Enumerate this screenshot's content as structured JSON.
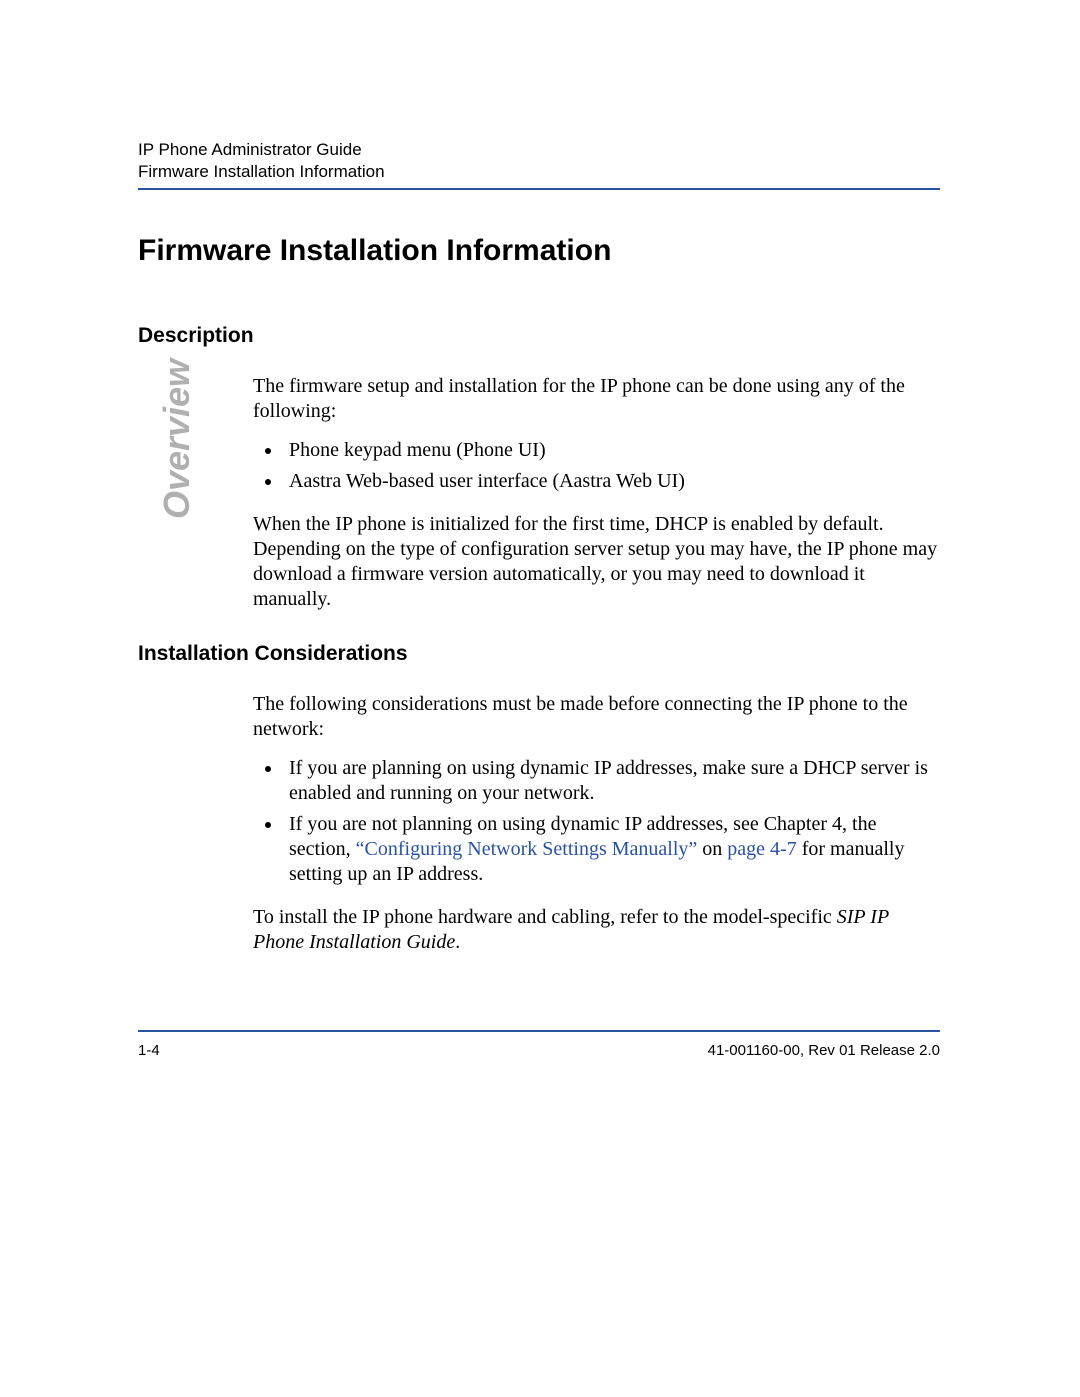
{
  "header": {
    "line1": "IP Phone Administrator Guide",
    "line2": "Firmware Installation Information"
  },
  "sideTab": "Overview",
  "mainTitle": "Firmware Installation Information",
  "sections": {
    "description": {
      "title": "Description",
      "intro": "The firmware setup and installation for the IP phone can be done using any of the following:",
      "bullets": [
        "Phone keypad menu (Phone UI)",
        "Aastra Web-based user interface (Aastra Web UI)"
      ],
      "para2": "When the IP phone is initialized for the first time, DHCP is enabled by default. Depending on the type of configuration server setup you may have, the IP phone may download a firmware version automatically, or you may need to download it manually."
    },
    "considerations": {
      "title": "Installation Considerations",
      "intro": "The following considerations must be made before connecting the IP phone to the network:",
      "bullets": [
        {
          "text": "If you are planning on using dynamic IP addresses, make sure a DHCP server is enabled and running on your network."
        },
        {
          "prefix": "If you are not planning on using dynamic IP addresses, see Chapter 4, the section, ",
          "linkText": "“Configuring Network Settings Manually”",
          "mid": " on ",
          "pageRef": "page 4-7",
          "suffix": " for manually setting up an IP address."
        }
      ],
      "closingPrefix": "To install the IP phone hardware and cabling, refer to the model-specific ",
      "closingItalic": "SIP IP Phone Installation Guide",
      "closingSuffix": "."
    }
  },
  "footer": {
    "left": "1-4",
    "right": "41-001160-00, Rev 01 Release 2.0"
  }
}
